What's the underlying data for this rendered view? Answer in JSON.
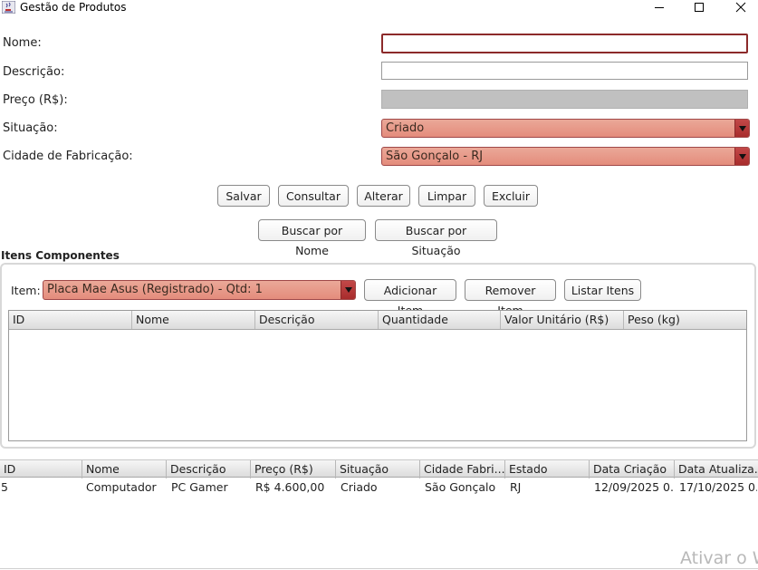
{
  "window": {
    "title": "Gestão de Produtos",
    "icons": {
      "app": "java-cup-icon",
      "minimize": "minimize-icon",
      "maximize": "maximize-icon",
      "close": "close-icon"
    }
  },
  "form": {
    "nome_label": "Nome:",
    "nome_value": "",
    "descricao_label": "Descrição:",
    "descricao_value": "",
    "preco_label": "Preço (R$):",
    "preco_value": "",
    "situacao_label": "Situação:",
    "situacao_value": "Criado",
    "cidade_label": "Cidade de Fabricação:",
    "cidade_value": "São Gonçalo - RJ"
  },
  "actions": {
    "salvar": "Salvar",
    "consultar": "Consultar",
    "alterar": "Alterar",
    "limpar": "Limpar",
    "excluir": "Excluir",
    "buscar_nome": "Buscar por Nome",
    "buscar_situacao": "Buscar por Situação"
  },
  "itens": {
    "section_title": "Itens Componentes",
    "item_label": "Item:",
    "item_value": "Placa Mae Asus (Registrado) - Qtd: 1",
    "adicionar": "Adicionar Item",
    "remover": "Remover Item",
    "listar": "Listar Itens",
    "columns": [
      "ID",
      "Nome",
      "Descrição",
      "Quantidade",
      "Valor Unitário (R$)",
      "Peso (kg)"
    ],
    "rows": []
  },
  "produtos": {
    "columns": [
      "ID",
      "Nome",
      "Descrição",
      "Preço (R$)",
      "Situação",
      "Cidade Fabri...",
      "Estado",
      "Data Criação",
      "Data Atualiza..."
    ],
    "rows": [
      [
        "5",
        "Computador",
        "PC Gamer",
        "R$ 4.600,00",
        "Criado",
        "São Gonçalo",
        "RJ",
        "12/09/2025 0...",
        "17/10/2025 0..."
      ]
    ]
  },
  "watermark": "Ativar o W",
  "colors": {
    "combo_fill": "#e8a090",
    "combo_arrow": "#b83a3a",
    "focus_border": "#8c2a2a",
    "disabled_field": "#c0c0c0"
  }
}
